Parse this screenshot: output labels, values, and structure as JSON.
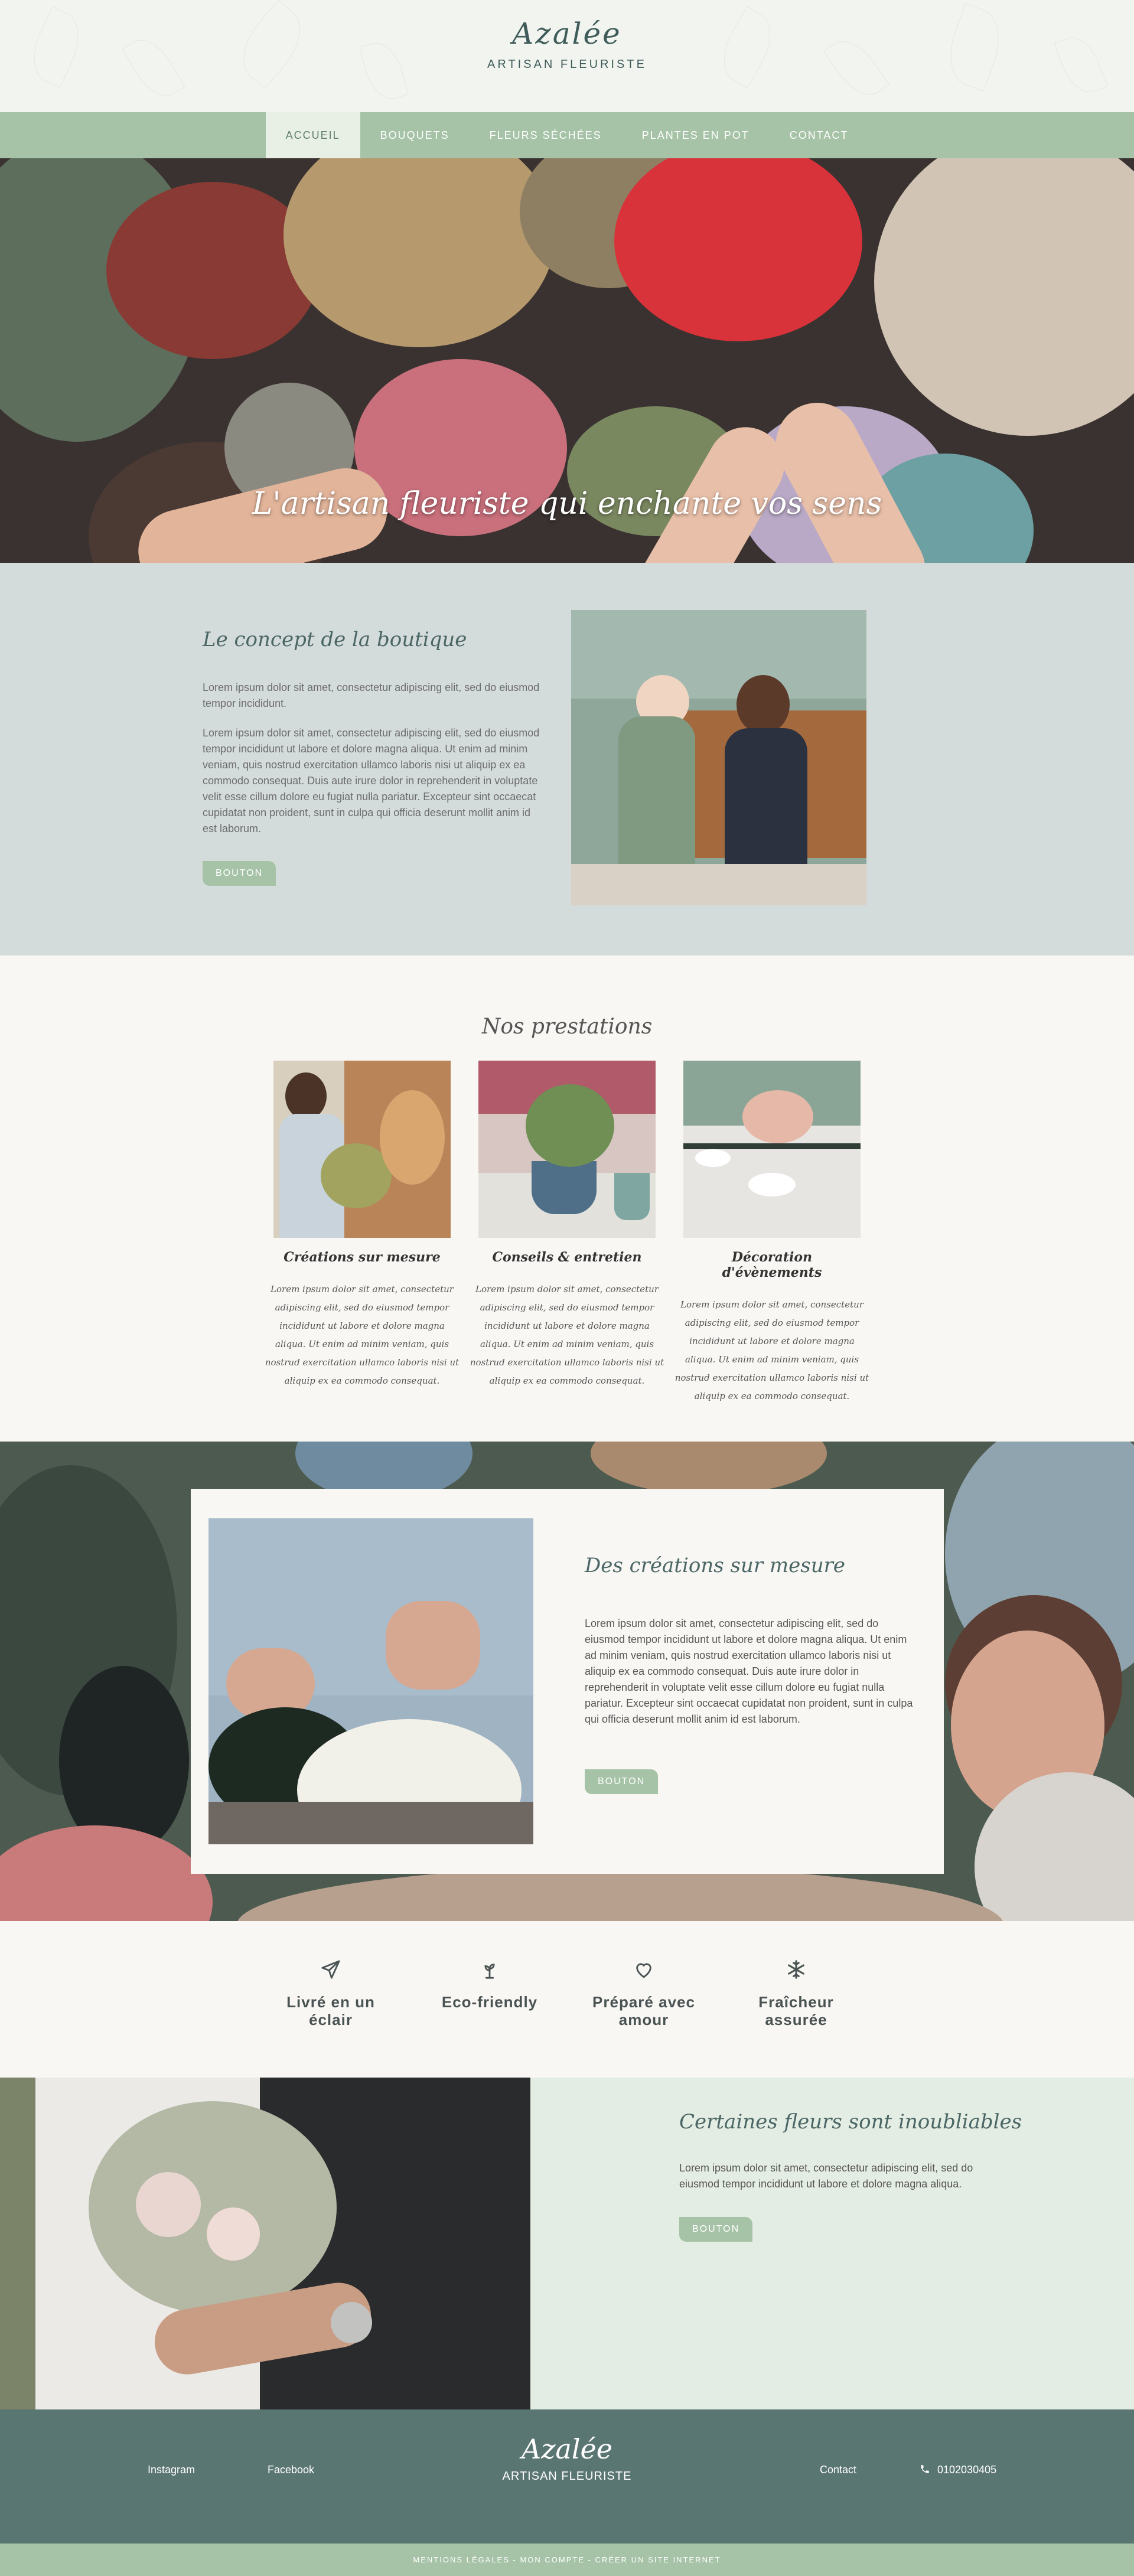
{
  "header": {
    "logo": "Azalée",
    "tagline": "ARTISAN FLEURISTE"
  },
  "nav": {
    "items": [
      "ACCUEIL",
      "BOUQUETS",
      "FLEURS SÉCHÉES",
      "PLANTES EN POT",
      "CONTACT"
    ],
    "active": "ACCUEIL"
  },
  "hero": {
    "title": "L'artisan fleuriste qui enchante vos sens"
  },
  "concept": {
    "title": "Le concept de la boutique",
    "paragraph1": "Lorem ipsum dolor sit amet, consectetur adipiscing elit, sed do eiusmod tempor incididunt.",
    "paragraph2": "Lorem ipsum dolor sit amet, consectetur adipiscing elit, sed do eiusmod tempor incididunt ut labore et dolore magna aliqua. Ut enim ad minim veniam, quis nostrud exercitation ullamco laboris nisi ut aliquip ex ea commodo consequat. Duis aute irure dolor in reprehenderit in voluptate velit esse cillum dolore eu fugiat nulla pariatur. Excepteur sint occaecat cupidatat non proident, sunt in culpa qui officia deserunt mollit anim id est laborum.",
    "button": "BOUTON"
  },
  "services": {
    "title": "Nos prestations",
    "items": [
      {
        "title": "Créations sur mesure",
        "text": "Lorem ipsum dolor sit amet, consectetur adipiscing elit, sed do eiusmod tempor incididunt ut labore et dolore magna aliqua. Ut enim ad minim veniam, quis nostrud exercitation ullamco laboris nisi ut aliquip ex ea commodo consequat."
      },
      {
        "title": "Conseils & entretien",
        "text": "Lorem ipsum dolor sit amet, consectetur adipiscing elit, sed do eiusmod tempor incididunt ut labore et dolore magna aliqua. Ut enim ad minim veniam, quis nostrud exercitation ullamco laboris nisi ut aliquip ex ea commodo consequat."
      },
      {
        "title": "Décoration d'évènements",
        "text": "Lorem ipsum dolor sit amet, consectetur adipiscing elit, sed do eiusmod tempor incididunt ut labore et dolore magna aliqua. Ut enim ad minim veniam, quis nostrud exercitation ullamco laboris nisi ut aliquip ex ea commodo consequat."
      }
    ]
  },
  "custom": {
    "title": "Des créations sur mesure",
    "text": "Lorem ipsum dolor sit amet, consectetur adipiscing elit, sed do eiusmod tempor incididunt ut labore et dolore magna aliqua. Ut enim ad minim veniam, quis nostrud exercitation ullamco laboris nisi ut aliquip ex ea commodo consequat. Duis aute irure dolor in reprehenderit in voluptate velit esse cillum dolore eu fugiat nulla pariatur. Excepteur sint occaecat cupidatat non proident, sunt in culpa qui officia deserunt mollit anim id est laborum.",
    "button": "BOUTON"
  },
  "features": [
    {
      "icon": "paper-plane-icon",
      "label": "Livré en un éclair"
    },
    {
      "icon": "sprout-icon",
      "label": "Eco-friendly"
    },
    {
      "icon": "heart-icon",
      "label": "Préparé avec amour"
    },
    {
      "icon": "snowflake-icon",
      "label": "Fraîcheur assurée"
    }
  ],
  "unforgettable": {
    "title": "Certaines fleurs sont inoubliables",
    "text": "Lorem ipsum dolor sit amet, consectetur adipiscing elit, sed do eiusmod tempor incididunt ut labore et dolore magna aliqua.",
    "button": "BOUTON"
  },
  "footer": {
    "instagram": "Instagram",
    "facebook": "Facebook",
    "logo": "Azalée",
    "tagline": "ARTISAN FLEURISTE",
    "contact": "Contact",
    "phone": "0102030405",
    "bottom": "MENTIONS LÉGALES - MON COMPTE - CRÉER UN SITE INTERNET"
  },
  "colors": {
    "sage": "#a6c3a7",
    "teal_dark": "#5a7673",
    "concept_bg": "#d4dcdb",
    "cream": "#f9f7f4",
    "mint_light": "#e4ede3"
  }
}
